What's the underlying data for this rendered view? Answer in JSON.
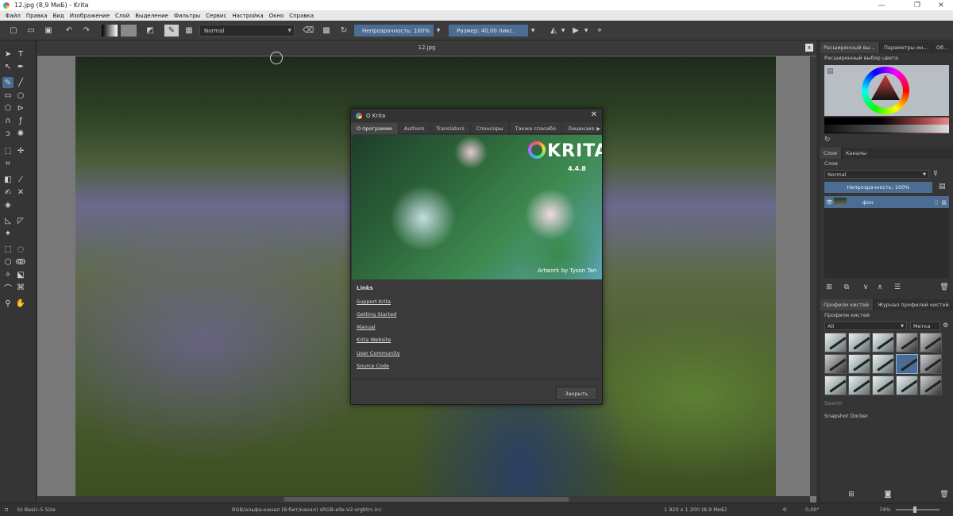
{
  "window": {
    "title": "12.jpg (8,9 МиБ)  - Krita",
    "minimize": "—",
    "maximize": "❐",
    "close": "✕"
  },
  "menu": [
    "Файл",
    "Правка",
    "Вид",
    "Изображение",
    "Слой",
    "Выделение",
    "Фильтры",
    "Сервис",
    "Настройка",
    "Окно",
    "Справка"
  ],
  "toolbar": {
    "blend_mode": "Normal",
    "opacity": "Непрозрачность: 100%",
    "size": "Размер: 40,00 пикс."
  },
  "document": {
    "tab_title": "12.jpg",
    "close_icon": "x"
  },
  "dock": {
    "color_tabs": [
      "Расширенный вы...",
      "Параметры ин...",
      "Об..."
    ],
    "color_title": "Расширенный выбор цвета",
    "layer_tabs": [
      "Слои",
      "Каналы"
    ],
    "layers_label": "Слои",
    "layer_blend": "Normal",
    "layer_opacity": "Непрозрачность: 100%",
    "layers": [
      {
        "name": "фон"
      }
    ],
    "brush_tabs": [
      "Профили кистей",
      "Журнал профилей кистей"
    ],
    "brush_label": "Профили кистей",
    "brush_filter": "All",
    "brush_tag": "Метка",
    "brush_search": "Search",
    "snapshot_title": "Snapshot Docker"
  },
  "about": {
    "title": "О Krita",
    "tabs": [
      "О программе",
      "Authors",
      "Translators",
      "Спонсоры",
      "Также спасибо",
      "Лицензия"
    ],
    "active_tab": "О программе",
    "logo_text": "KRITA",
    "version": "4.4.8",
    "artwork_credit": "Artwork by Tyson Tan",
    "links_title": "Links",
    "links": [
      "Support Krita",
      "Getting Started",
      "Manual",
      "Krita Website",
      "User Community",
      "Source Code"
    ],
    "close_button": "Закрыть"
  },
  "status": {
    "brush": "b) Basic-5 Size",
    "color_space": "RGB/альфа-канал (8-бит/канал)  sRGB-elle-V2-srgbtrc.icc",
    "image_size": "1 920 x 1 200 (8,9 МиБ)",
    "rotation": "0,00°",
    "zoom": "74%"
  },
  "colors": {
    "accent": "#4b6d93",
    "panel": "#353535",
    "dialog": "#3a3a3a"
  }
}
